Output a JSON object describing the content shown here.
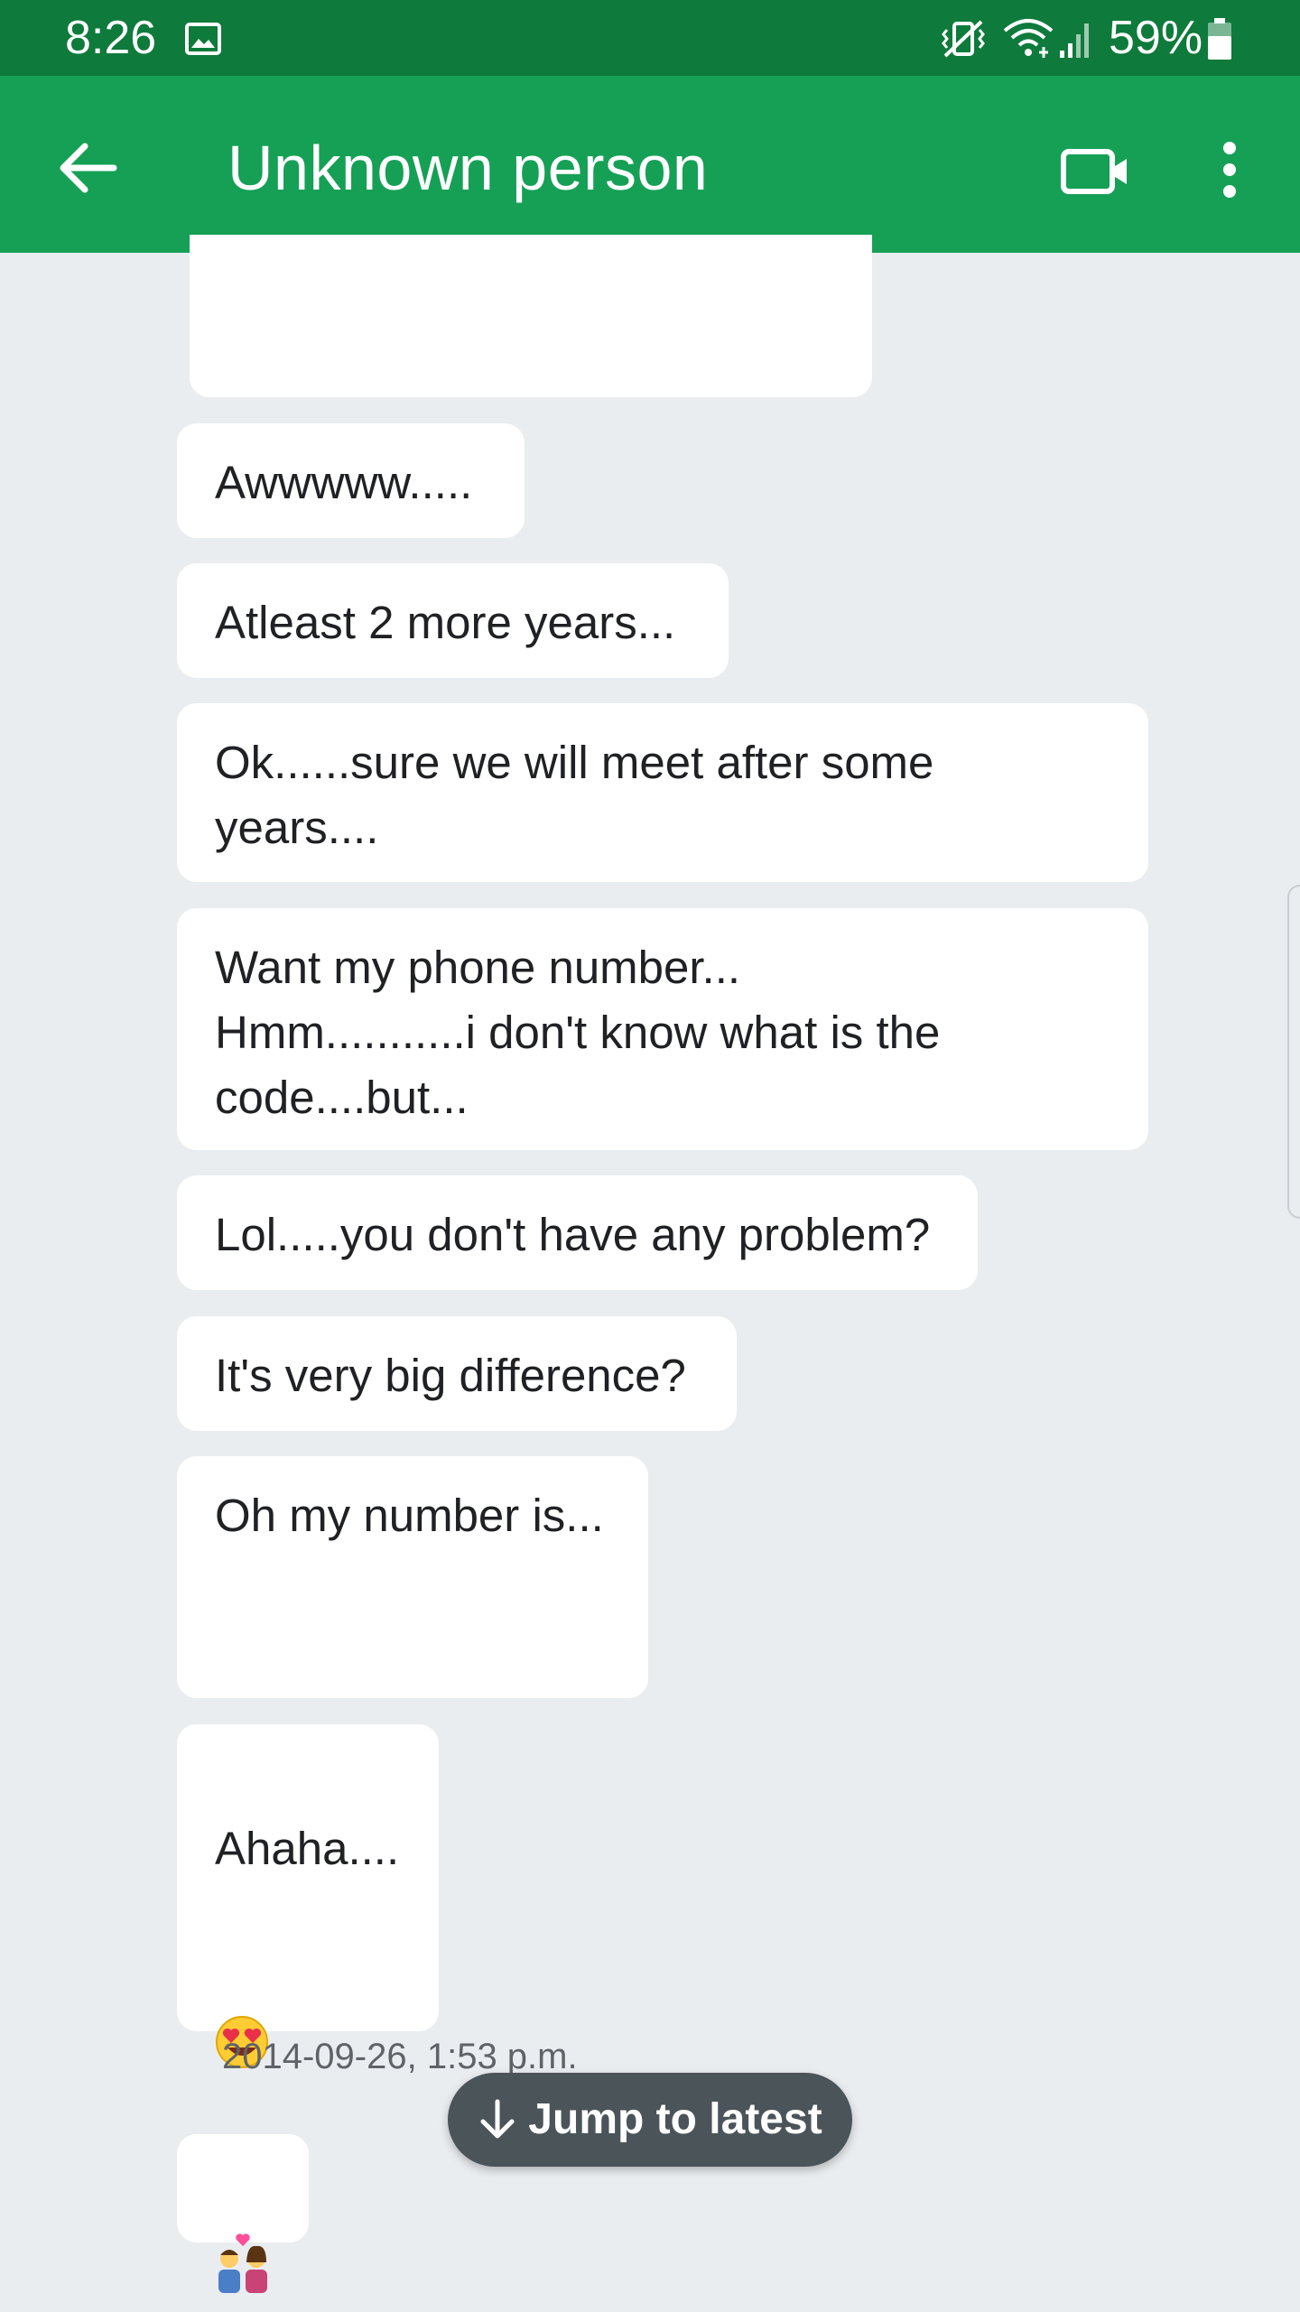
{
  "status_bar": {
    "time": "8:26",
    "battery": "59%",
    "icons": [
      "gallery-icon",
      "vibrate-icon",
      "wifi-icon",
      "signal-icon",
      "battery-icon"
    ]
  },
  "app_bar": {
    "title": "Unknown person",
    "icons": [
      "back-arrow-icon",
      "video-call-icon",
      "more-vert-icon"
    ],
    "background_color": "#15a056",
    "status_color": "#0e7a3b"
  },
  "messages": [
    {
      "text": ""
    },
    {
      "text": "Awwwww....."
    },
    {
      "text": "Atleast 2 more years..."
    },
    {
      "text": "Ok......sure we will meet after some\nyears...."
    },
    {
      "text": "Want my phone number...\nHmm...........i don't know what is the\ncode....but..."
    },
    {
      "text": "Lol.....you don't have any problem?"
    },
    {
      "text": "It's very big difference?"
    },
    {
      "text": "Oh my number is..."
    },
    {
      "text": "Ahaha....",
      "emoji": "smiling-face-with-heart-eyes"
    },
    {
      "text": "",
      "emoji": "kiss-couple"
    }
  ],
  "timestamp": "2014-09-26, 1:53 p.m.",
  "jump_button": {
    "label": "Jump to latest",
    "icon": "arrow-down-icon"
  }
}
